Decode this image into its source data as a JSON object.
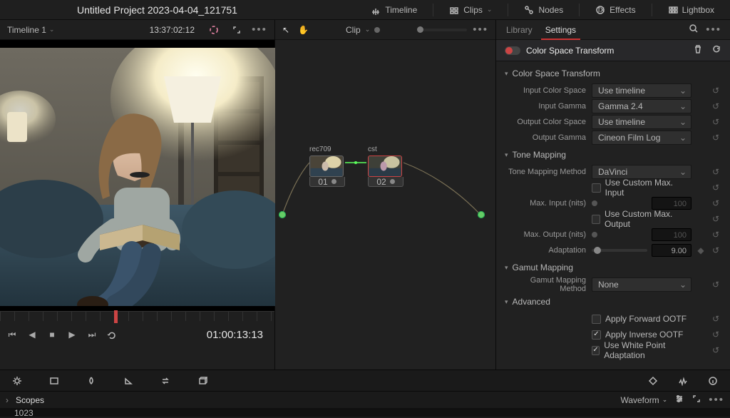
{
  "project_title": "Untitled Project 2023-04-04_121751",
  "topbar": {
    "timeline": "Timeline",
    "clips": "Clips",
    "nodes": "Nodes",
    "effects": "Effects",
    "lightbox": "Lightbox"
  },
  "viewer": {
    "timeline_name": "Timeline 1",
    "timecode_head": "13:37:02:12",
    "timecode_transport": "01:00:13:13"
  },
  "node_panel": {
    "mode": "Clip",
    "nodes": [
      {
        "label": "rec709",
        "num": "01"
      },
      {
        "label": "cst",
        "num": "02"
      }
    ]
  },
  "inspector": {
    "tabs": {
      "library": "Library",
      "settings": "Settings"
    },
    "fx_name": "Color Space Transform",
    "sections": {
      "cst": "Color Space Transform",
      "tone": "Tone Mapping",
      "gamut": "Gamut Mapping",
      "adv": "Advanced"
    },
    "labels": {
      "in_cs": "Input Color Space",
      "in_g": "Input Gamma",
      "out_cs": "Output Color Space",
      "out_g": "Output Gamma",
      "tm_method": "Tone Mapping Method",
      "cust_in": "Use Custom Max. Input",
      "max_in": "Max. Input (nits)",
      "cust_out": "Use Custom Max. Output",
      "max_out": "Max. Output (nits)",
      "adapt": "Adaptation",
      "gm_method": "Gamut Mapping Method",
      "fwd_ootf": "Apply Forward OOTF",
      "inv_ootf": "Apply Inverse OOTF",
      "wp": "Use White Point Adaptation"
    },
    "values": {
      "in_cs": "Use timeline",
      "in_g": "Gamma 2.4",
      "out_cs": "Use timeline",
      "out_g": "Cineon Film Log",
      "tm_method": "DaVinci",
      "max_in": "100",
      "max_out": "100",
      "adapt": "9.00",
      "gm_method": "None"
    }
  },
  "scopes": {
    "title": "Scopes",
    "mode": "Waveform",
    "scale": "1023"
  }
}
